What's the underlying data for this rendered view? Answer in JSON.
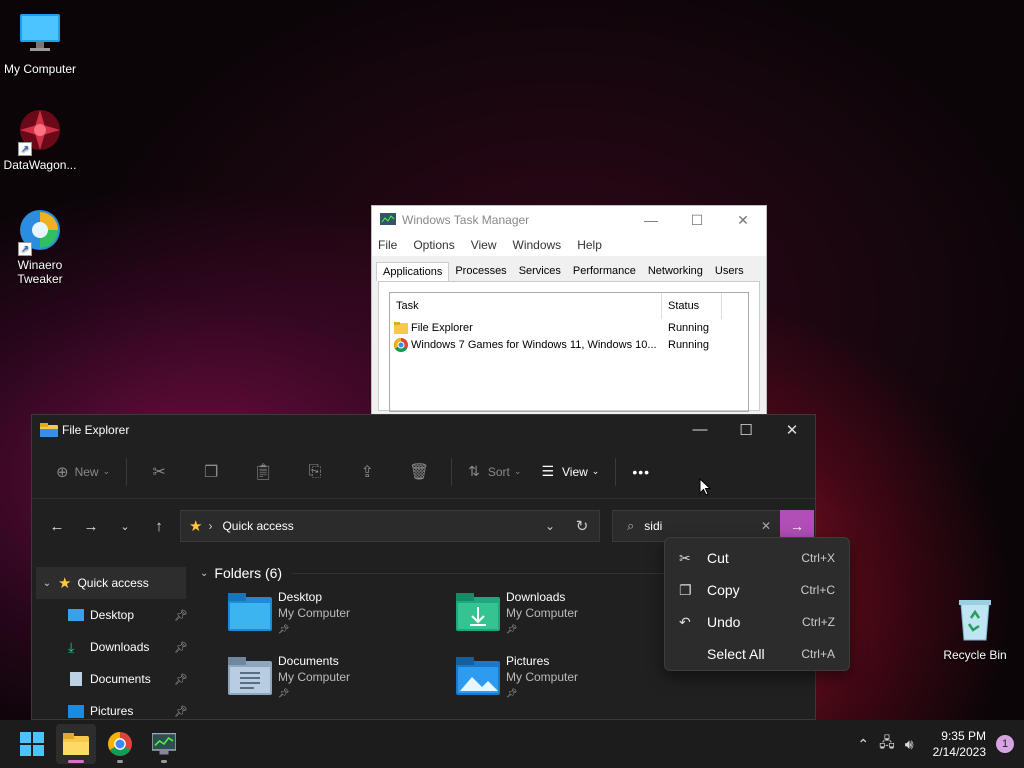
{
  "desktop": {
    "icons": [
      {
        "label": "My Computer"
      },
      {
        "label": "DataWagon..."
      },
      {
        "label": "Winaero Tweaker"
      },
      {
        "label": "Recycle Bin"
      }
    ]
  },
  "task_manager": {
    "title": "Windows Task Manager",
    "menu": [
      "File",
      "Options",
      "View",
      "Windows",
      "Help"
    ],
    "tabs": [
      "Applications",
      "Processes",
      "Services",
      "Performance",
      "Networking",
      "Users"
    ],
    "active_tab": "Applications",
    "columns": [
      "Task",
      "Status"
    ],
    "rows": [
      {
        "task": "File Explorer",
        "status": "Running"
      },
      {
        "task": "Windows 7 Games for Windows 11, Windows 10...",
        "status": "Running"
      }
    ]
  },
  "file_explorer": {
    "title": "File Explorer",
    "toolbar": {
      "new": "New",
      "sort": "Sort",
      "view": "View",
      "more": "•••"
    },
    "address": {
      "location": "Quick access"
    },
    "search": {
      "value": "sidi"
    },
    "sidebar": [
      {
        "label": "Quick access"
      },
      {
        "label": "Desktop"
      },
      {
        "label": "Downloads"
      },
      {
        "label": "Documents"
      },
      {
        "label": "Pictures"
      }
    ],
    "section_title": "Folders (6)",
    "folders": [
      {
        "name": "Desktop",
        "location": "My Computer"
      },
      {
        "name": "Downloads",
        "location": "My Computer"
      },
      {
        "name": "Documents",
        "location": "My Computer"
      },
      {
        "name": "Pictures",
        "location": "My Computer"
      }
    ]
  },
  "context_menu": {
    "items": [
      {
        "label": "Cut",
        "shortcut": "Ctrl+X"
      },
      {
        "label": "Copy",
        "shortcut": "Ctrl+C"
      },
      {
        "label": "Undo",
        "shortcut": "Ctrl+Z"
      },
      {
        "label": "Select All",
        "shortcut": "Ctrl+A"
      }
    ]
  },
  "taskbar": {
    "time": "9:35 PM",
    "date": "2/14/2023",
    "notification_count": "1"
  }
}
